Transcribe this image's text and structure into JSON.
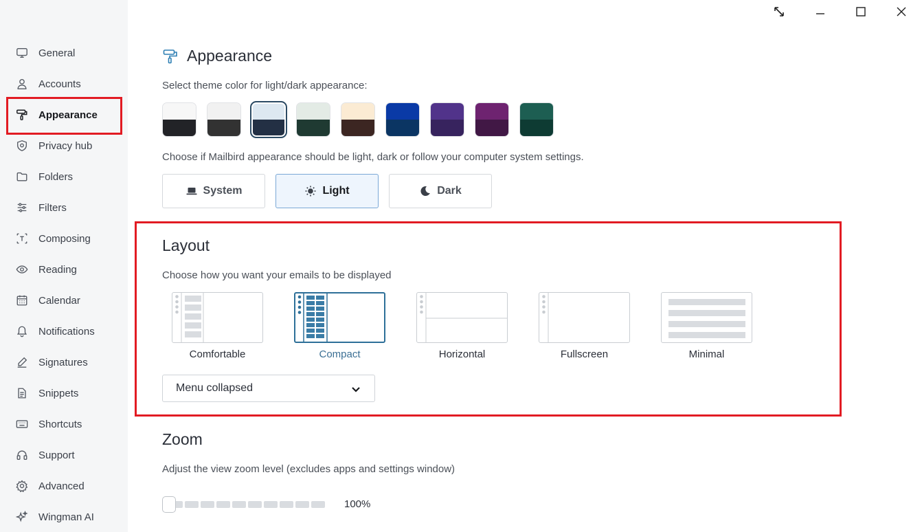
{
  "window_controls": {
    "resize": "resize-icon",
    "minimize": "minimize-icon",
    "maximize": "maximize-icon",
    "close": "close-icon"
  },
  "sidebar": {
    "items": [
      {
        "label": "General",
        "icon": "monitor-icon"
      },
      {
        "label": "Accounts",
        "icon": "user-icon"
      },
      {
        "label": "Appearance",
        "icon": "paint-roller-icon",
        "active": true
      },
      {
        "label": "Privacy hub",
        "icon": "shield-icon"
      },
      {
        "label": "Folders",
        "icon": "folder-icon"
      },
      {
        "label": "Filters",
        "icon": "sliders-icon"
      },
      {
        "label": "Composing",
        "icon": "text-cursor-icon"
      },
      {
        "label": "Reading",
        "icon": "eye-icon"
      },
      {
        "label": "Calendar",
        "icon": "calendar-icon"
      },
      {
        "label": "Notifications",
        "icon": "bell-icon"
      },
      {
        "label": "Signatures",
        "icon": "pen-icon"
      },
      {
        "label": "Snippets",
        "icon": "document-icon"
      },
      {
        "label": "Shortcuts",
        "icon": "keyboard-icon"
      },
      {
        "label": "Support",
        "icon": "headset-icon"
      },
      {
        "label": "Advanced",
        "icon": "gear-icon"
      },
      {
        "label": "Wingman AI",
        "icon": "sparkle-icon"
      }
    ]
  },
  "appearance": {
    "title": "Appearance",
    "theme_desc": "Select theme color for light/dark appearance:",
    "swatches": [
      {
        "top": "#f7f7f7",
        "bottom": "#222327"
      },
      {
        "top": "#f1f1f1",
        "bottom": "#323232"
      },
      {
        "top": "#dde8f1",
        "bottom": "#233044",
        "selected": true
      },
      {
        "top": "#e3ebe5",
        "bottom": "#1f3a32"
      },
      {
        "top": "#fbebd3",
        "bottom": "#3c2622"
      },
      {
        "top": "#0a3aa6",
        "bottom": "#0b3563"
      },
      {
        "top": "#51338a",
        "bottom": "#37235e"
      },
      {
        "top": "#6e2370",
        "bottom": "#411845"
      },
      {
        "top": "#1d5e52",
        "bottom": "#0e3b33"
      }
    ],
    "mode_desc": "Choose if Mailbird appearance should be light, dark or follow your computer system settings.",
    "modes": {
      "system": "System",
      "light": "Light",
      "dark": "Dark"
    },
    "selected_mode": "Light"
  },
  "layout": {
    "title": "Layout",
    "desc": "Choose how you want your emails to be displayed",
    "options": {
      "comfortable": "Comfortable",
      "compact": "Compact",
      "horizontal": "Horizontal",
      "fullscreen": "Fullscreen",
      "minimal": "Minimal"
    },
    "selected": "Compact",
    "menu_value": "Menu collapsed"
  },
  "zoom": {
    "title": "Zoom",
    "desc": "Adjust the view zoom level (excludes apps and settings window)",
    "value": "100%",
    "level_fraction": 0
  },
  "colors": {
    "highlight": "#e21b23",
    "accent": "#2d6f98"
  }
}
